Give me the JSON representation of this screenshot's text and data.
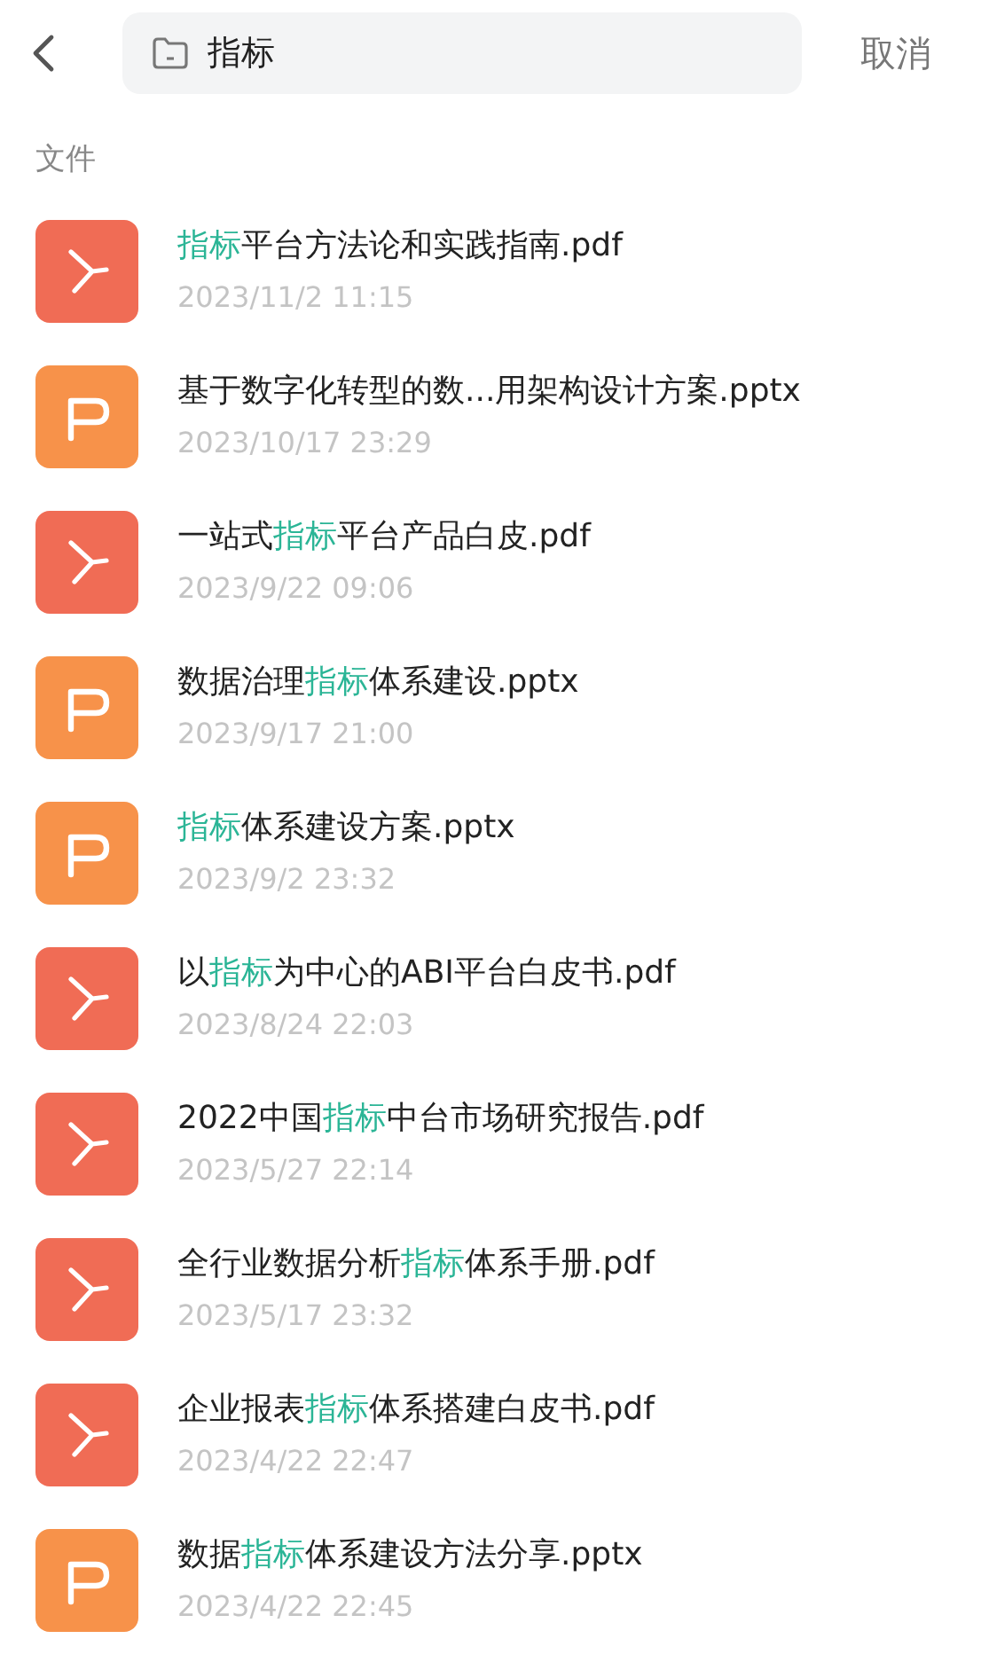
{
  "search": {
    "value": "指标"
  },
  "cancel": "取消",
  "section": "文件",
  "files": [
    {
      "kind": "pdf",
      "name": [
        {
          "text": "指标",
          "highlight": true
        },
        {
          "text": "平台方法论和实践指南.pdf",
          "highlight": false
        }
      ],
      "date": "2023/11/2 11:15"
    },
    {
      "kind": "pptx",
      "name": [
        {
          "text": "基于数字化转型的数...用架构设计方案.pptx",
          "highlight": false
        }
      ],
      "date": "2023/10/17 23:29"
    },
    {
      "kind": "pdf",
      "name": [
        {
          "text": "一站式",
          "highlight": false
        },
        {
          "text": "指标",
          "highlight": true
        },
        {
          "text": "平台产品白皮.pdf",
          "highlight": false
        }
      ],
      "date": "2023/9/22 09:06"
    },
    {
      "kind": "pptx",
      "name": [
        {
          "text": "数据治理",
          "highlight": false
        },
        {
          "text": "指标",
          "highlight": true
        },
        {
          "text": "体系建设.pptx",
          "highlight": false
        }
      ],
      "date": "2023/9/17 21:00"
    },
    {
      "kind": "pptx",
      "name": [
        {
          "text": "指标",
          "highlight": true
        },
        {
          "text": "体系建设方案.pptx",
          "highlight": false
        }
      ],
      "date": "2023/9/2 23:32"
    },
    {
      "kind": "pdf",
      "name": [
        {
          "text": "以",
          "highlight": false
        },
        {
          "text": "指标",
          "highlight": true
        },
        {
          "text": "为中心的ABI平台白皮书.pdf",
          "highlight": false
        }
      ],
      "date": "2023/8/24 22:03"
    },
    {
      "kind": "pdf",
      "name": [
        {
          "text": "2022中国",
          "highlight": false
        },
        {
          "text": "指标",
          "highlight": true
        },
        {
          "text": "中台市场研究报告.pdf",
          "highlight": false
        }
      ],
      "date": "2023/5/27 22:14"
    },
    {
      "kind": "pdf",
      "name": [
        {
          "text": "全行业数据分析",
          "highlight": false
        },
        {
          "text": "指标",
          "highlight": true
        },
        {
          "text": "体系手册.pdf",
          "highlight": false
        }
      ],
      "date": "2023/5/17 23:32"
    },
    {
      "kind": "pdf",
      "name": [
        {
          "text": "企业报表",
          "highlight": false
        },
        {
          "text": "指标",
          "highlight": true
        },
        {
          "text": "体系搭建白皮书.pdf",
          "highlight": false
        }
      ],
      "date": "2023/4/22 22:47"
    },
    {
      "kind": "pptx",
      "name": [
        {
          "text": "数据",
          "highlight": false
        },
        {
          "text": "指标",
          "highlight": true
        },
        {
          "text": "体系建设方法分享.pptx",
          "highlight": false
        }
      ],
      "date": "2023/4/22 22:45"
    }
  ]
}
